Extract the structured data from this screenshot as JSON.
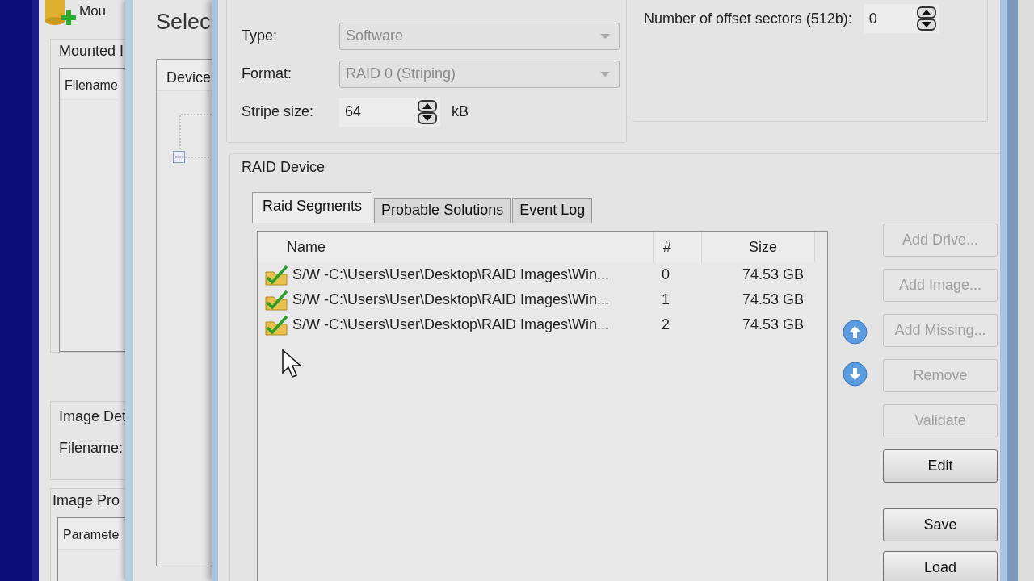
{
  "back_window": {
    "toolbar_button": "Mou",
    "mounted_group": "Mounted I",
    "mounted_column": "Filename",
    "details_group": "Image Det",
    "details_label": "Filename:",
    "properties_tab": "Image Pro",
    "properties_column": "Paramete"
  },
  "middle_window": {
    "title": "Selec",
    "device_column": "Device",
    "tree_expanded": true
  },
  "raid_window": {
    "fields": [
      {
        "label": "Type:",
        "value": "Software",
        "kind": "dropdown",
        "disabled": true
      },
      {
        "label": "Format:",
        "value": "RAID 0 (Striping)",
        "kind": "dropdown",
        "disabled": true
      },
      {
        "label": "Stripe size:",
        "value": "64",
        "kind": "spinner",
        "unit": "kB",
        "disabled": false
      }
    ],
    "offset": {
      "label": "Number of offset sectors (512b):",
      "value": "0"
    },
    "device_group": "RAID Device",
    "tabs": [
      {
        "label": "Raid Segments",
        "selected": true
      },
      {
        "label": "Probable Solutions",
        "selected": false
      },
      {
        "label": "Event Log",
        "selected": false
      }
    ],
    "columns": [
      "Name",
      "#",
      "Size"
    ],
    "rows": [
      {
        "name": "S/W -C:\\Users\\User\\Desktop\\RAID Images\\Win...",
        "index": "0",
        "size": "74.53 GB"
      },
      {
        "name": "S/W -C:\\Users\\User\\Desktop\\RAID Images\\Win...",
        "index": "1",
        "size": "74.53 GB"
      },
      {
        "name": "S/W -C:\\Users\\User\\Desktop\\RAID Images\\Win...",
        "index": "2",
        "size": "74.53 GB"
      }
    ],
    "buttons": [
      {
        "label": "Add Drive...",
        "disabled": true
      },
      {
        "label": "Add Image...",
        "disabled": true
      },
      {
        "label": "Add Missing...",
        "disabled": true
      },
      {
        "label": "Remove",
        "disabled": true
      },
      {
        "label": "Validate",
        "disabled": true
      },
      {
        "label": "Edit",
        "disabled": false
      },
      {
        "label": "Save",
        "disabled": false
      },
      {
        "label": "Load",
        "disabled": false
      }
    ]
  }
}
